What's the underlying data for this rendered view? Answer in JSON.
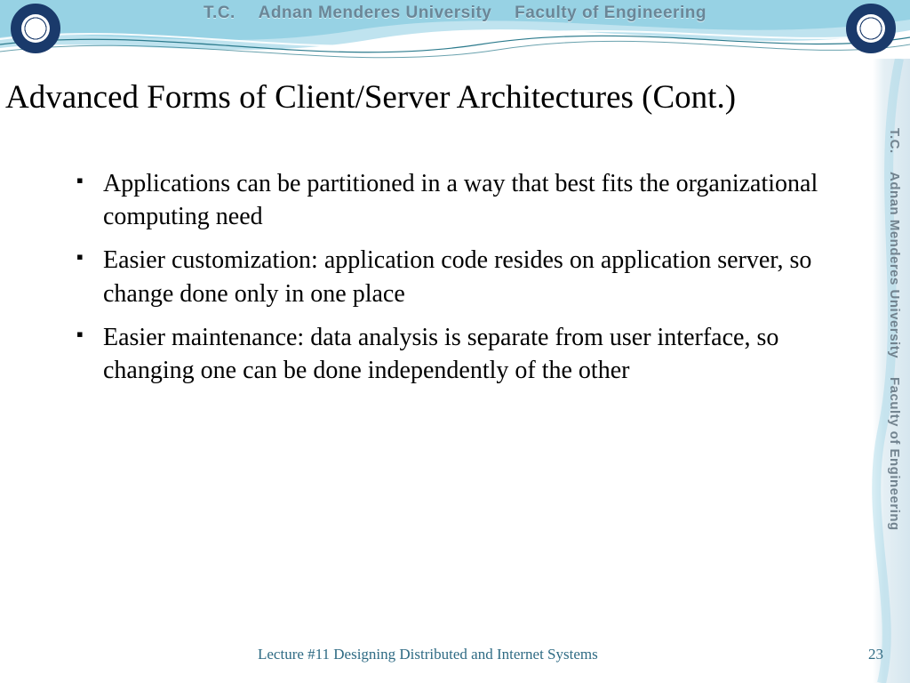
{
  "banner": {
    "tc": "T.C.",
    "university": "Adnan Menderes University",
    "faculty": "Faculty of Engineering"
  },
  "side": {
    "tc": "T.C.",
    "university": "Adnan Menderes University",
    "faculty": "Faculty of Engineering"
  },
  "title": "Advanced Forms of Client/Server Architectures (Cont.)",
  "bullets": [
    "Applications can be partitioned in a way that best fits the organizational computing need",
    "Easier customization: application code resides on application server, so change done only in one place",
    "Easier maintenance: data analysis is separate from user interface, so changing one can be done independently of the other"
  ],
  "footer": {
    "lecture": "Lecture #11 Designing Distributed and Internet Systems",
    "page": "23"
  }
}
